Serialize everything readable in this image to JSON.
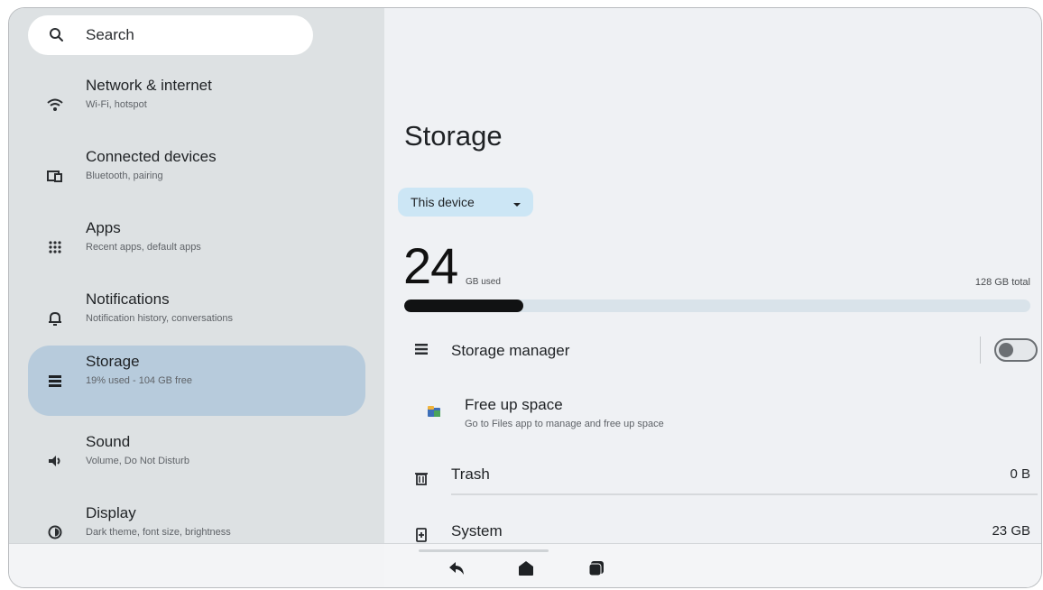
{
  "search": {
    "label": "Search"
  },
  "sidebar": {
    "items": [
      {
        "title": "Network & internet",
        "subtitle": "Wi-Fi, hotspot",
        "icon": "wifi-icon"
      },
      {
        "title": "Connected devices",
        "subtitle": "Bluetooth, pairing",
        "icon": "connected-devices-icon"
      },
      {
        "title": "Apps",
        "subtitle": "Recent apps, default apps",
        "icon": "apps-grid-icon"
      },
      {
        "title": "Notifications",
        "subtitle": "Notification history, conversations",
        "icon": "bell-icon"
      },
      {
        "title": "Storage",
        "subtitle": "19% used - 104 GB free",
        "icon": "storage-icon",
        "active": true
      },
      {
        "title": "Sound",
        "subtitle": "Volume, Do Not Disturb",
        "icon": "speaker-icon"
      },
      {
        "title": "Display",
        "subtitle": "Dark theme, font size, brightness",
        "icon": "brightness-icon"
      }
    ]
  },
  "main": {
    "title": "Storage",
    "device_select": "This device",
    "used_amount": "24",
    "used_label": "GB used",
    "total_label": "128 GB total",
    "used_fraction": 0.19,
    "storage_manager": {
      "title": "Storage manager",
      "enabled": false
    },
    "free_up": {
      "title": "Free up space",
      "subtitle": "Go to Files app to manage and free up space"
    },
    "trash": {
      "title": "Trash",
      "value": "0 B"
    },
    "system": {
      "title": "System",
      "value": "23 GB"
    }
  },
  "colors": {
    "sidebar_bg": "#dde1e3",
    "active_item": "#b7cbdc",
    "select_bg": "#cce6f5",
    "bar_fill": "#111213",
    "bar_track": "#d9e3ea"
  },
  "navbar": {
    "icons": [
      "back-icon",
      "home-icon",
      "recents-icon"
    ]
  }
}
